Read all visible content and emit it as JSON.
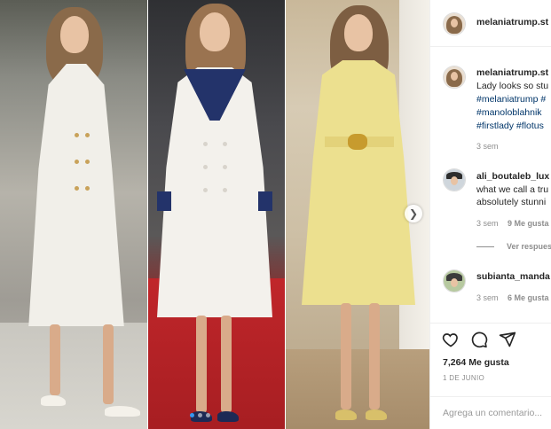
{
  "post": {
    "username": "melaniatrump.st",
    "header_username": "melaniatrump.st"
  },
  "caption": {
    "username": "melaniatrump.st",
    "text": "Lady looks so stu",
    "tags": [
      "#melaniatrump #",
      "#manoloblahnik",
      "#firstlady #flotus"
    ],
    "time": "3 sem"
  },
  "comments": [
    {
      "username": "ali_boutaleb_lux",
      "lines": [
        "what we call a tru",
        "absolutely stunni"
      ],
      "time": "3 sem",
      "likes": "9 Me gusta",
      "replies_label": "Ver respues"
    },
    {
      "username": "subianta_manda",
      "lines": [],
      "time": "3 sem",
      "likes": "6 Me gusta"
    }
  ],
  "actions": {
    "icons": [
      "heart-icon",
      "comment-icon",
      "share-icon"
    ],
    "likes_count": "7,264 Me gusta",
    "date": "1 DE JUNIO",
    "comment_placeholder": "Agrega un comentario..."
  },
  "media": {
    "panels": [
      "white-coat",
      "white-navy-coat",
      "yellow-coat"
    ],
    "carousel_count": 3,
    "carousel_active": 1
  },
  "colors": {
    "link": "#003569",
    "accent": "#3897f0",
    "muted": "#8e8e8e"
  }
}
